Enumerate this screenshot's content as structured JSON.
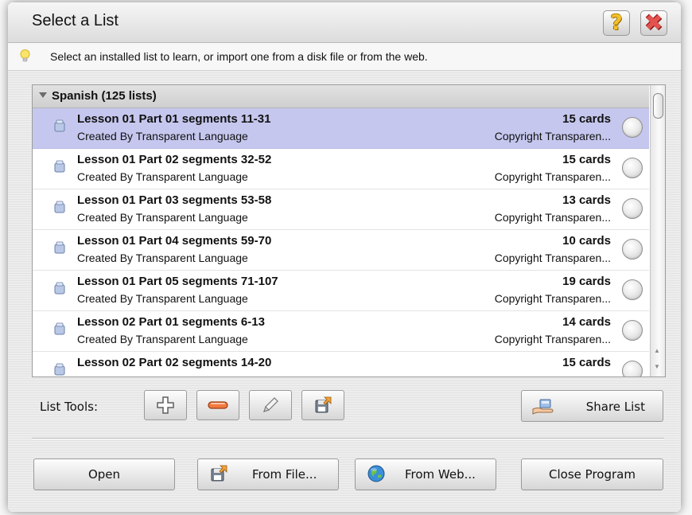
{
  "window": {
    "title": "Select a List"
  },
  "titlebar": {
    "help_icon": "question-mark-icon",
    "close_icon": "close-x-icon"
  },
  "hint": {
    "icon": "lightbulb-icon",
    "text": "Select an installed list to learn, or import one from a disk file or from the web."
  },
  "list": {
    "group_label": "Spanish (125 lists)",
    "rows": [
      {
        "title": "Lesson 01 Part 01 segments 11-31",
        "author": "Created By Transparent Language",
        "cards": "15 cards",
        "copyright": "Copyright Transparen...",
        "selected": true
      },
      {
        "title": "Lesson 01 Part 02 segments 32-52",
        "author": "Created By Transparent Language",
        "cards": "15 cards",
        "copyright": "Copyright Transparen...",
        "selected": false
      },
      {
        "title": "Lesson 01 Part 03 segments 53-58",
        "author": "Created By Transparent Language",
        "cards": "13 cards",
        "copyright": "Copyright Transparen...",
        "selected": false
      },
      {
        "title": "Lesson 01 Part 04 segments 59-70",
        "author": "Created By Transparent Language",
        "cards": "10 cards",
        "copyright": "Copyright Transparen...",
        "selected": false
      },
      {
        "title": "Lesson 01 Part 05 segments 71-107",
        "author": "Created By Transparent Language",
        "cards": "19 cards",
        "copyright": "Copyright Transparen...",
        "selected": false
      },
      {
        "title": "Lesson 02 Part 01 segments 6-13",
        "author": "Created By Transparent Language",
        "cards": "14 cards",
        "copyright": "Copyright Transparen...",
        "selected": false
      },
      {
        "title": "Lesson 02 Part 02 segments 14-20",
        "author": "",
        "cards": "15 cards",
        "copyright": "",
        "selected": false
      }
    ]
  },
  "tools": {
    "label": "List Tools:",
    "add_icon": "plus-icon",
    "remove_icon": "minus-icon",
    "edit_icon": "pencil-icon",
    "export_icon": "disk-export-icon",
    "share_label": "Share List"
  },
  "bottom": {
    "open_label": "Open",
    "from_file_label": "From File...",
    "from_web_label": "From Web...",
    "close_label": "Close Program"
  },
  "colors": {
    "selected_row": "#c5c7ee",
    "close_red": "#e2524e",
    "help_yellow": "#f3c12b"
  }
}
